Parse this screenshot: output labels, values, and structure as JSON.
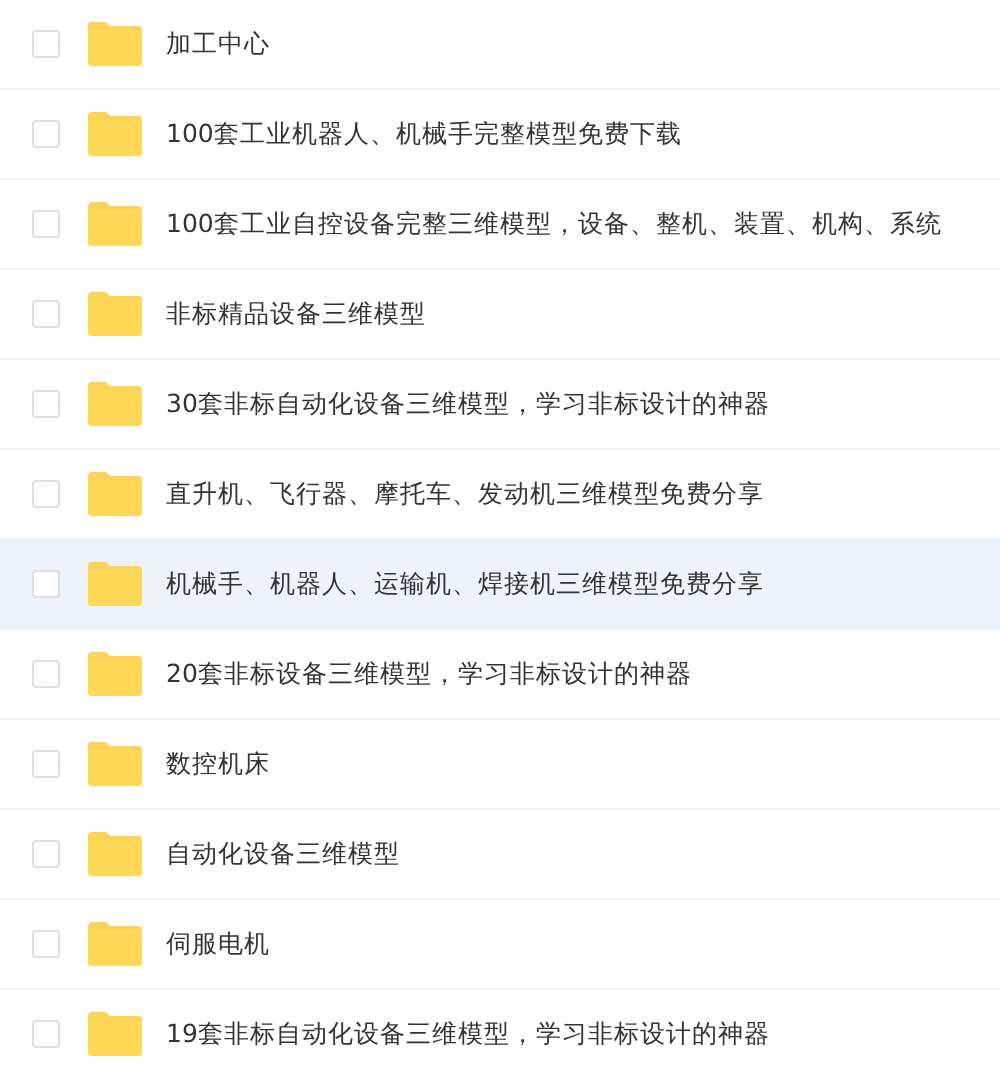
{
  "files": [
    {
      "name": "加工中心",
      "checked": false,
      "highlighted": false
    },
    {
      "name": "100套工业机器人、机械手完整模型免费下载",
      "checked": false,
      "highlighted": false
    },
    {
      "name": "100套工业自控设备完整三维模型，设备、整机、装置、机构、系统",
      "checked": false,
      "highlighted": false
    },
    {
      "name": "非标精品设备三维模型",
      "checked": false,
      "highlighted": false
    },
    {
      "name": "30套非标自动化设备三维模型，学习非标设计的神器",
      "checked": false,
      "highlighted": false
    },
    {
      "name": "直升机、飞行器、摩托车、发动机三维模型免费分享",
      "checked": false,
      "highlighted": false
    },
    {
      "name": "机械手、机器人、运输机、焊接机三维模型免费分享",
      "checked": false,
      "highlighted": true
    },
    {
      "name": "20套非标设备三维模型，学习非标设计的神器",
      "checked": false,
      "highlighted": false
    },
    {
      "name": "数控机床",
      "checked": false,
      "highlighted": false
    },
    {
      "name": "自动化设备三维模型",
      "checked": false,
      "highlighted": false
    },
    {
      "name": "伺服电机",
      "checked": false,
      "highlighted": false
    },
    {
      "name": "19套非标自动化设备三维模型，学习非标设计的神器",
      "checked": false,
      "highlighted": false
    }
  ]
}
